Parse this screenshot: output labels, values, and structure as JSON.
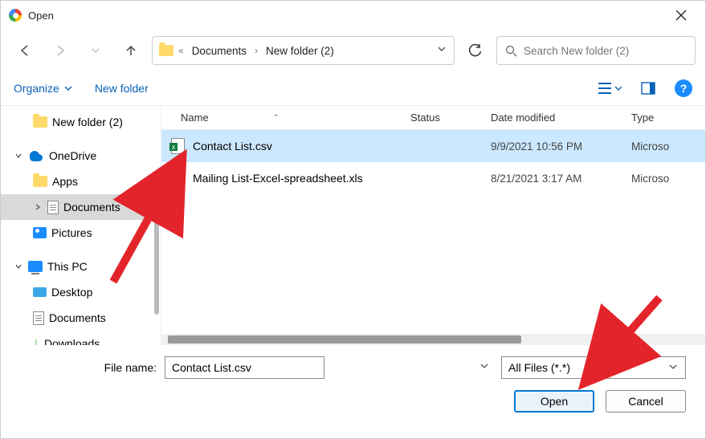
{
  "titlebar": {
    "title": "Open"
  },
  "breadcrumb": {
    "seg1": "Documents",
    "seg2": "New folder (2)",
    "chev": "«"
  },
  "search": {
    "placeholder": "Search New folder (2)"
  },
  "toolbar": {
    "organize": "Organize",
    "newfolder": "New folder"
  },
  "tree": {
    "newfolder": "New folder (2)",
    "onedrive": "OneDrive",
    "apps": "Apps",
    "documents": "Documents",
    "pictures": "Pictures",
    "thispc": "This PC",
    "desktop": "Desktop",
    "documents2": "Documents",
    "downloads": "Downloads"
  },
  "columns": {
    "name": "Name",
    "status": "Status",
    "date": "Date modified",
    "type": "Type"
  },
  "files": [
    {
      "name": "Contact List.csv",
      "date": "9/9/2021 10:56 PM",
      "type": "Microso"
    },
    {
      "name": "Mailing List-Excel-spreadsheet.xls",
      "date": "8/21/2021 3:17 AM",
      "type": "Microso"
    }
  ],
  "footer": {
    "filename_label": "File name:",
    "filename_value": "Contact List.csv",
    "filter": "All Files (*.*)",
    "open": "Open",
    "cancel": "Cancel"
  }
}
